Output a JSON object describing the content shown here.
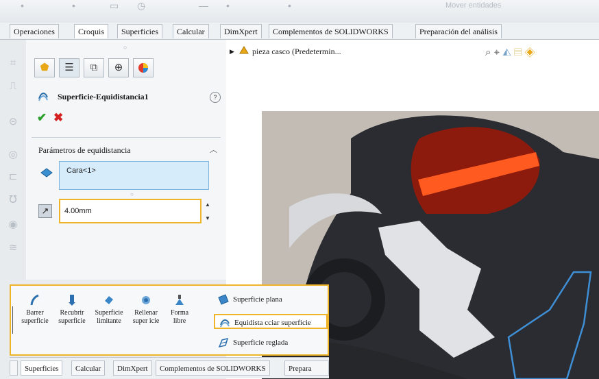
{
  "top_bar": {
    "hidden_label": "Mover entidades"
  },
  "command_tabs": [
    "Operaciones",
    "Croquis",
    "Superficies",
    "Calcular",
    "DimXpert",
    "Complementos de SOLIDWORKS",
    "Preparación del análisis"
  ],
  "active_command_tab": "Croquis",
  "property_manager": {
    "feature_title": "Superficie-Equidistancia1",
    "confirm_icon": "check-icon",
    "cancel_icon": "close-icon",
    "params_section_title": "Parámetros de equidistancia",
    "face_selection": "Cara<1>",
    "offset_distance": "4.00mm"
  },
  "feature_tree": {
    "root_label": "pieza casco  (Predetermin..."
  },
  "ribbon": {
    "buttons": [
      {
        "label_line1": "Barrer",
        "label_line2": "superficie"
      },
      {
        "label_line1": "Recubrir",
        "label_line2": "superficie"
      },
      {
        "label_line1": "Superficie",
        "label_line2": "limitante"
      },
      {
        "label_line1": "Rellenar",
        "label_line2": "super icie"
      },
      {
        "label_line1": "Forma",
        "label_line2": "libre"
      }
    ],
    "list_items": [
      "Superficie plana",
      "Equidista cciar superficie",
      "Superficie reglada"
    ]
  },
  "bottom_tabs": [
    "Superficies",
    "Calcular",
    "DimXpert",
    "Complementos de SOLIDWORKS",
    "Prepara"
  ],
  "colors": {
    "highlight": "#f0b428",
    "selection_fill": "#d6ecfb",
    "accept_green": "#2aa02a",
    "cancel_red": "#d42020"
  }
}
